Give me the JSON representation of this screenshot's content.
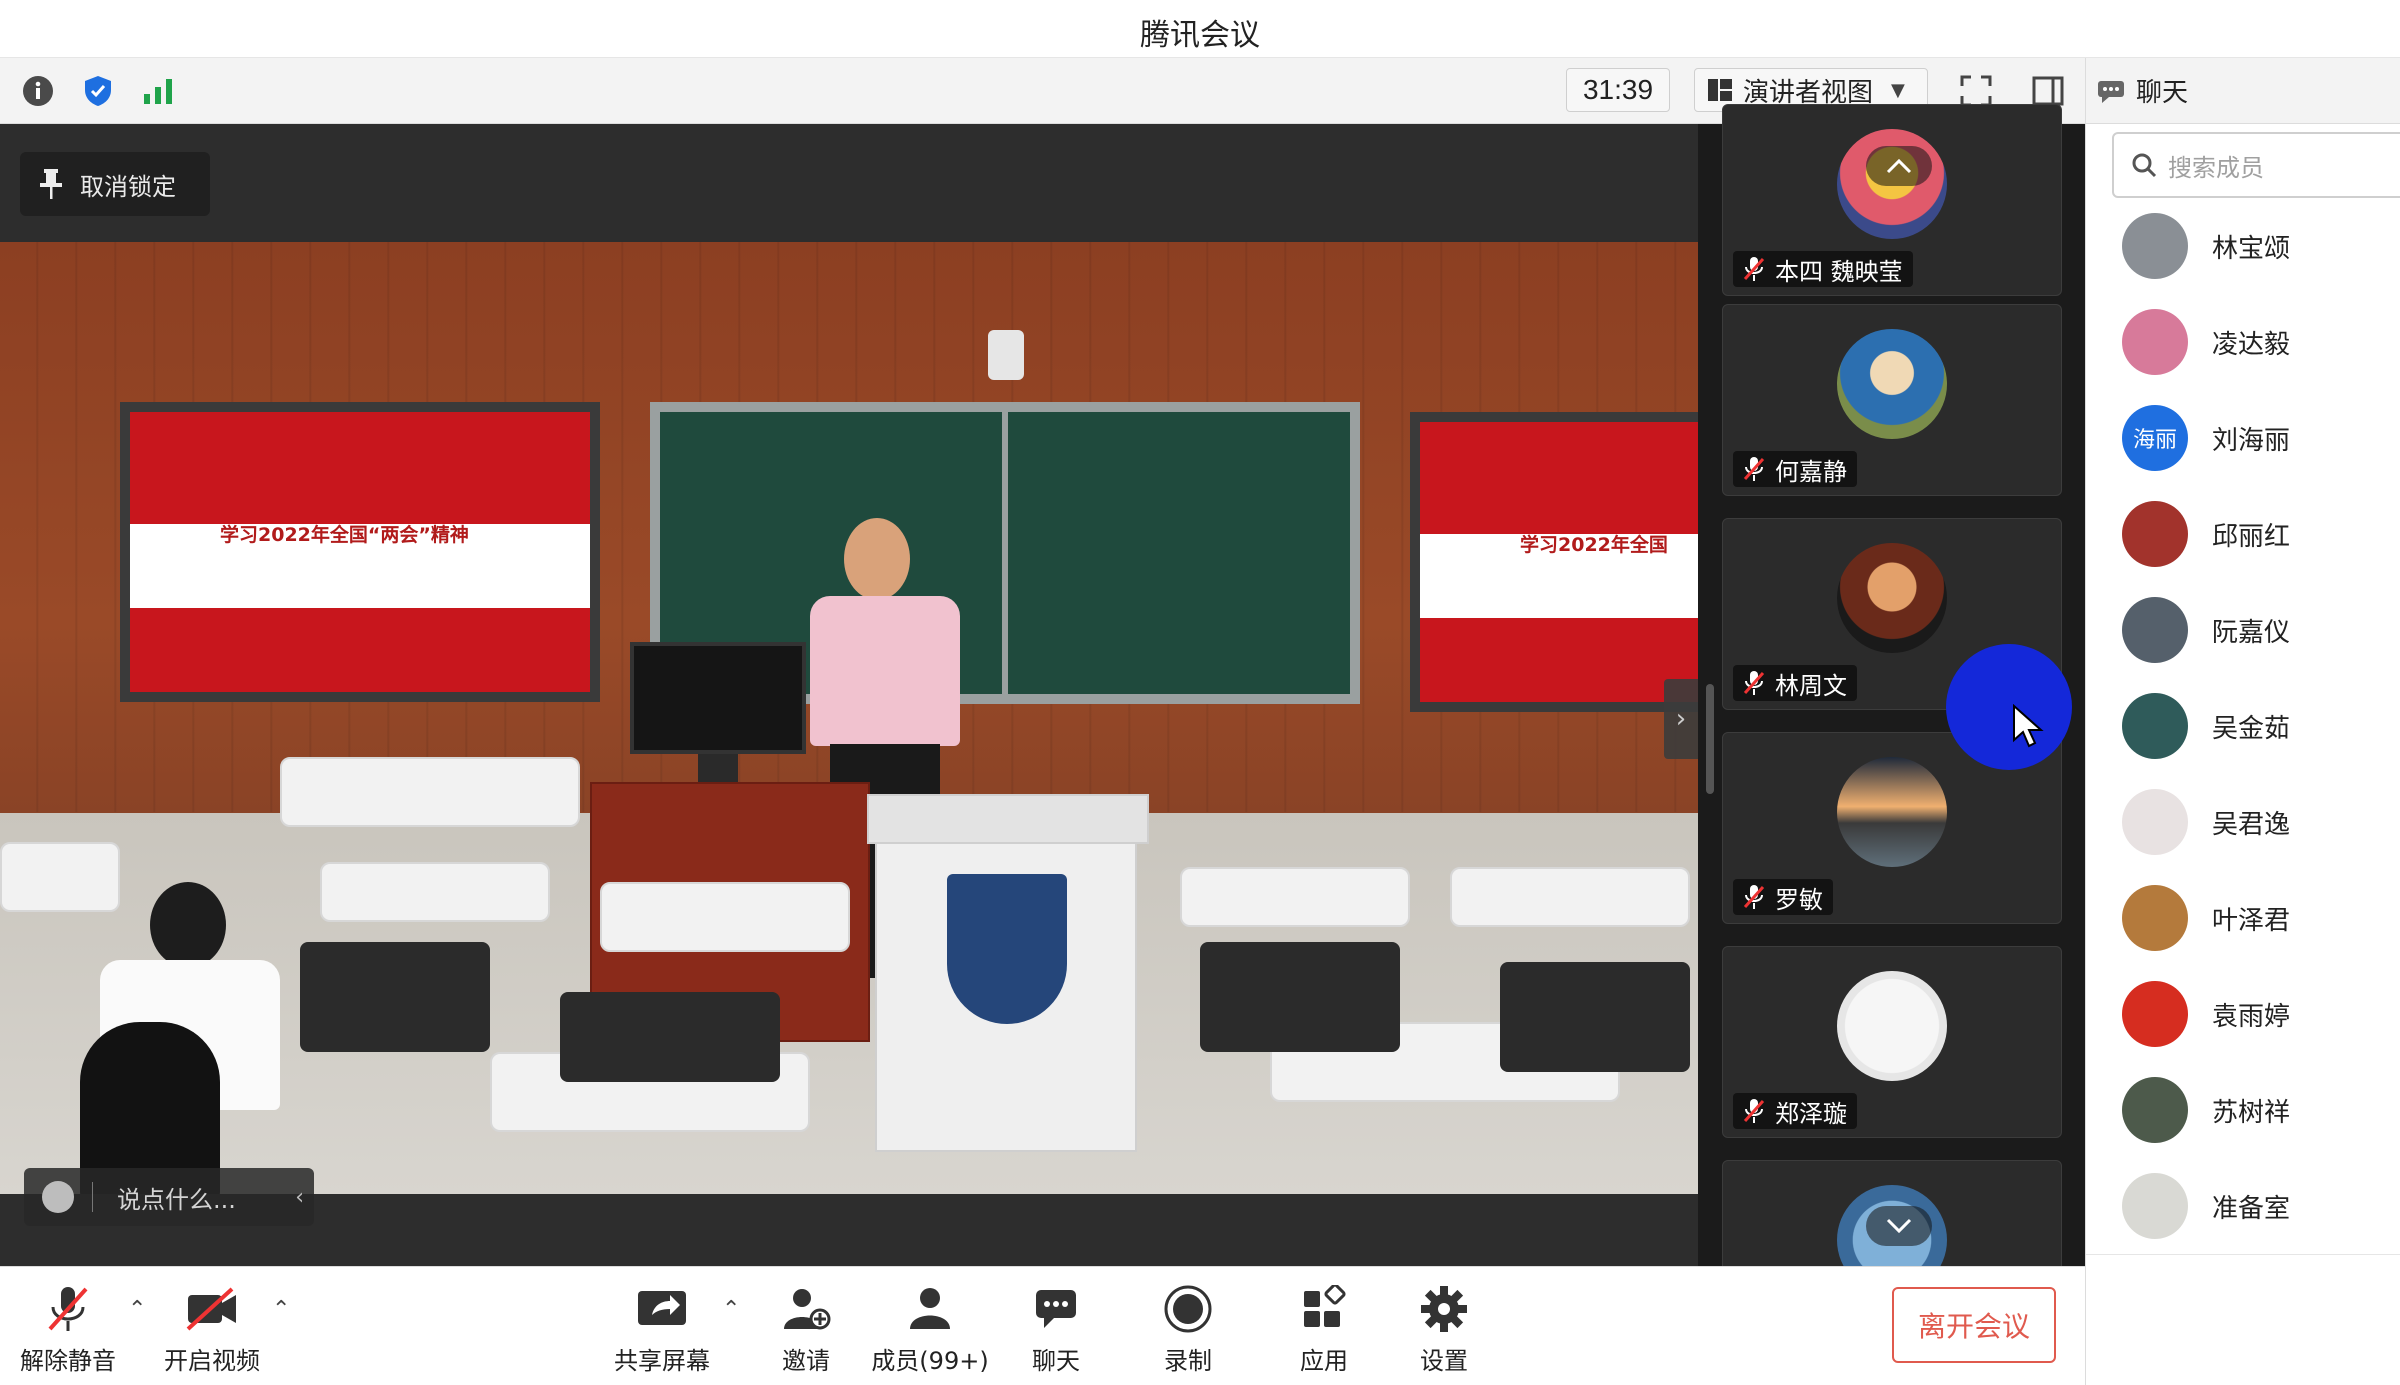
{
  "window": {
    "title": "腾讯会议"
  },
  "toolbar": {
    "timer": "31:39",
    "view_label": "演讲者视图",
    "icons": [
      "info-icon",
      "shield-icon",
      "signal-icon",
      "fullscreen-icon",
      "side-panel-icon"
    ]
  },
  "stage": {
    "unlock_label": "取消锁定",
    "comment_placeholder": "说点什么...",
    "screen_text": "学习2022年全国“两会”精神",
    "screen_text_right": "学习2022年全国"
  },
  "gallery": {
    "tiles": [
      {
        "name": "本四 魏映莹"
      },
      {
        "name": "何嘉静"
      },
      {
        "name": "林周文"
      },
      {
        "name": "罗敏"
      },
      {
        "name": "郑泽璇"
      }
    ]
  },
  "panel": {
    "title": "聊天",
    "search_placeholder": "搜索成员",
    "members": [
      {
        "name": "林宝颂",
        "avatar_color": "#8a8f95"
      },
      {
        "name": "凌达毅",
        "avatar_color": "#d77a9a"
      },
      {
        "name": "刘海丽",
        "avatar_color": "#1f6fe0",
        "avatar_text": "海丽"
      },
      {
        "name": "邱丽红",
        "avatar_color": "#a2332c"
      },
      {
        "name": "阮嘉仪",
        "avatar_color": "#55606b"
      },
      {
        "name": "吴金茹",
        "avatar_color": "#2f5b5a"
      },
      {
        "name": "吴君逸",
        "avatar_color": "#e8e2e2"
      },
      {
        "name": "叶泽君",
        "avatar_color": "#b47a3c"
      },
      {
        "name": "袁雨婷",
        "avatar_color": "#d62d20"
      },
      {
        "name": "苏树祥",
        "avatar_color": "#4d5a4b"
      },
      {
        "name": "准备室",
        "avatar_color": "#d9d9d4"
      }
    ]
  },
  "controls": {
    "unmute": "解除静音",
    "start_video": "开启视频",
    "share_screen": "共享屏幕",
    "invite": "邀请",
    "members": "成员(99+)",
    "chat": "聊天",
    "record": "录制",
    "apps": "应用",
    "settings": "设置",
    "leave": "离开会议"
  }
}
